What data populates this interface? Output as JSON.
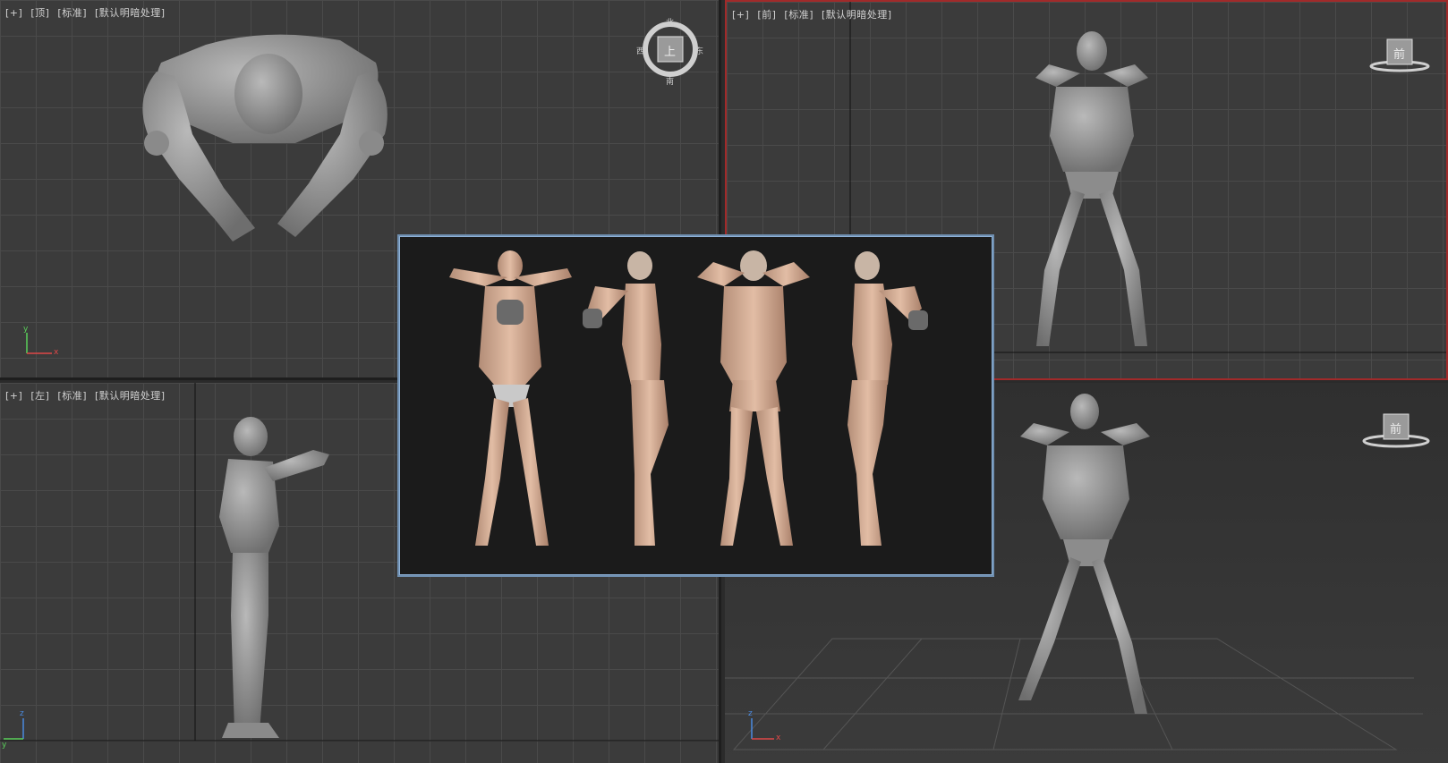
{
  "viewports": {
    "top": {
      "labels": [
        "[+]",
        "[顶]",
        "[标准]",
        "[默认明暗处理]"
      ]
    },
    "front": {
      "labels": [
        "[+]",
        "[前]",
        "[标准]",
        "[默认明暗处理]"
      ]
    },
    "left": {
      "labels": [
        "[+]",
        "[左]",
        "[标准]",
        "[默认明暗处理]"
      ]
    },
    "perspective": {
      "labels": []
    }
  },
  "viewcube": {
    "top": {
      "face": "上",
      "north": "北",
      "south": "南",
      "west": "西",
      "east": "东"
    },
    "front": {
      "face": "前"
    },
    "perspective": {
      "face": "前"
    }
  },
  "axes": {
    "top": [
      "y",
      "x"
    ],
    "left": [
      "z",
      "y"
    ],
    "perspective": [
      "z",
      "x"
    ]
  },
  "colors": {
    "active_border": "#a12a2a",
    "overlay_border": "#8fb3d9"
  }
}
